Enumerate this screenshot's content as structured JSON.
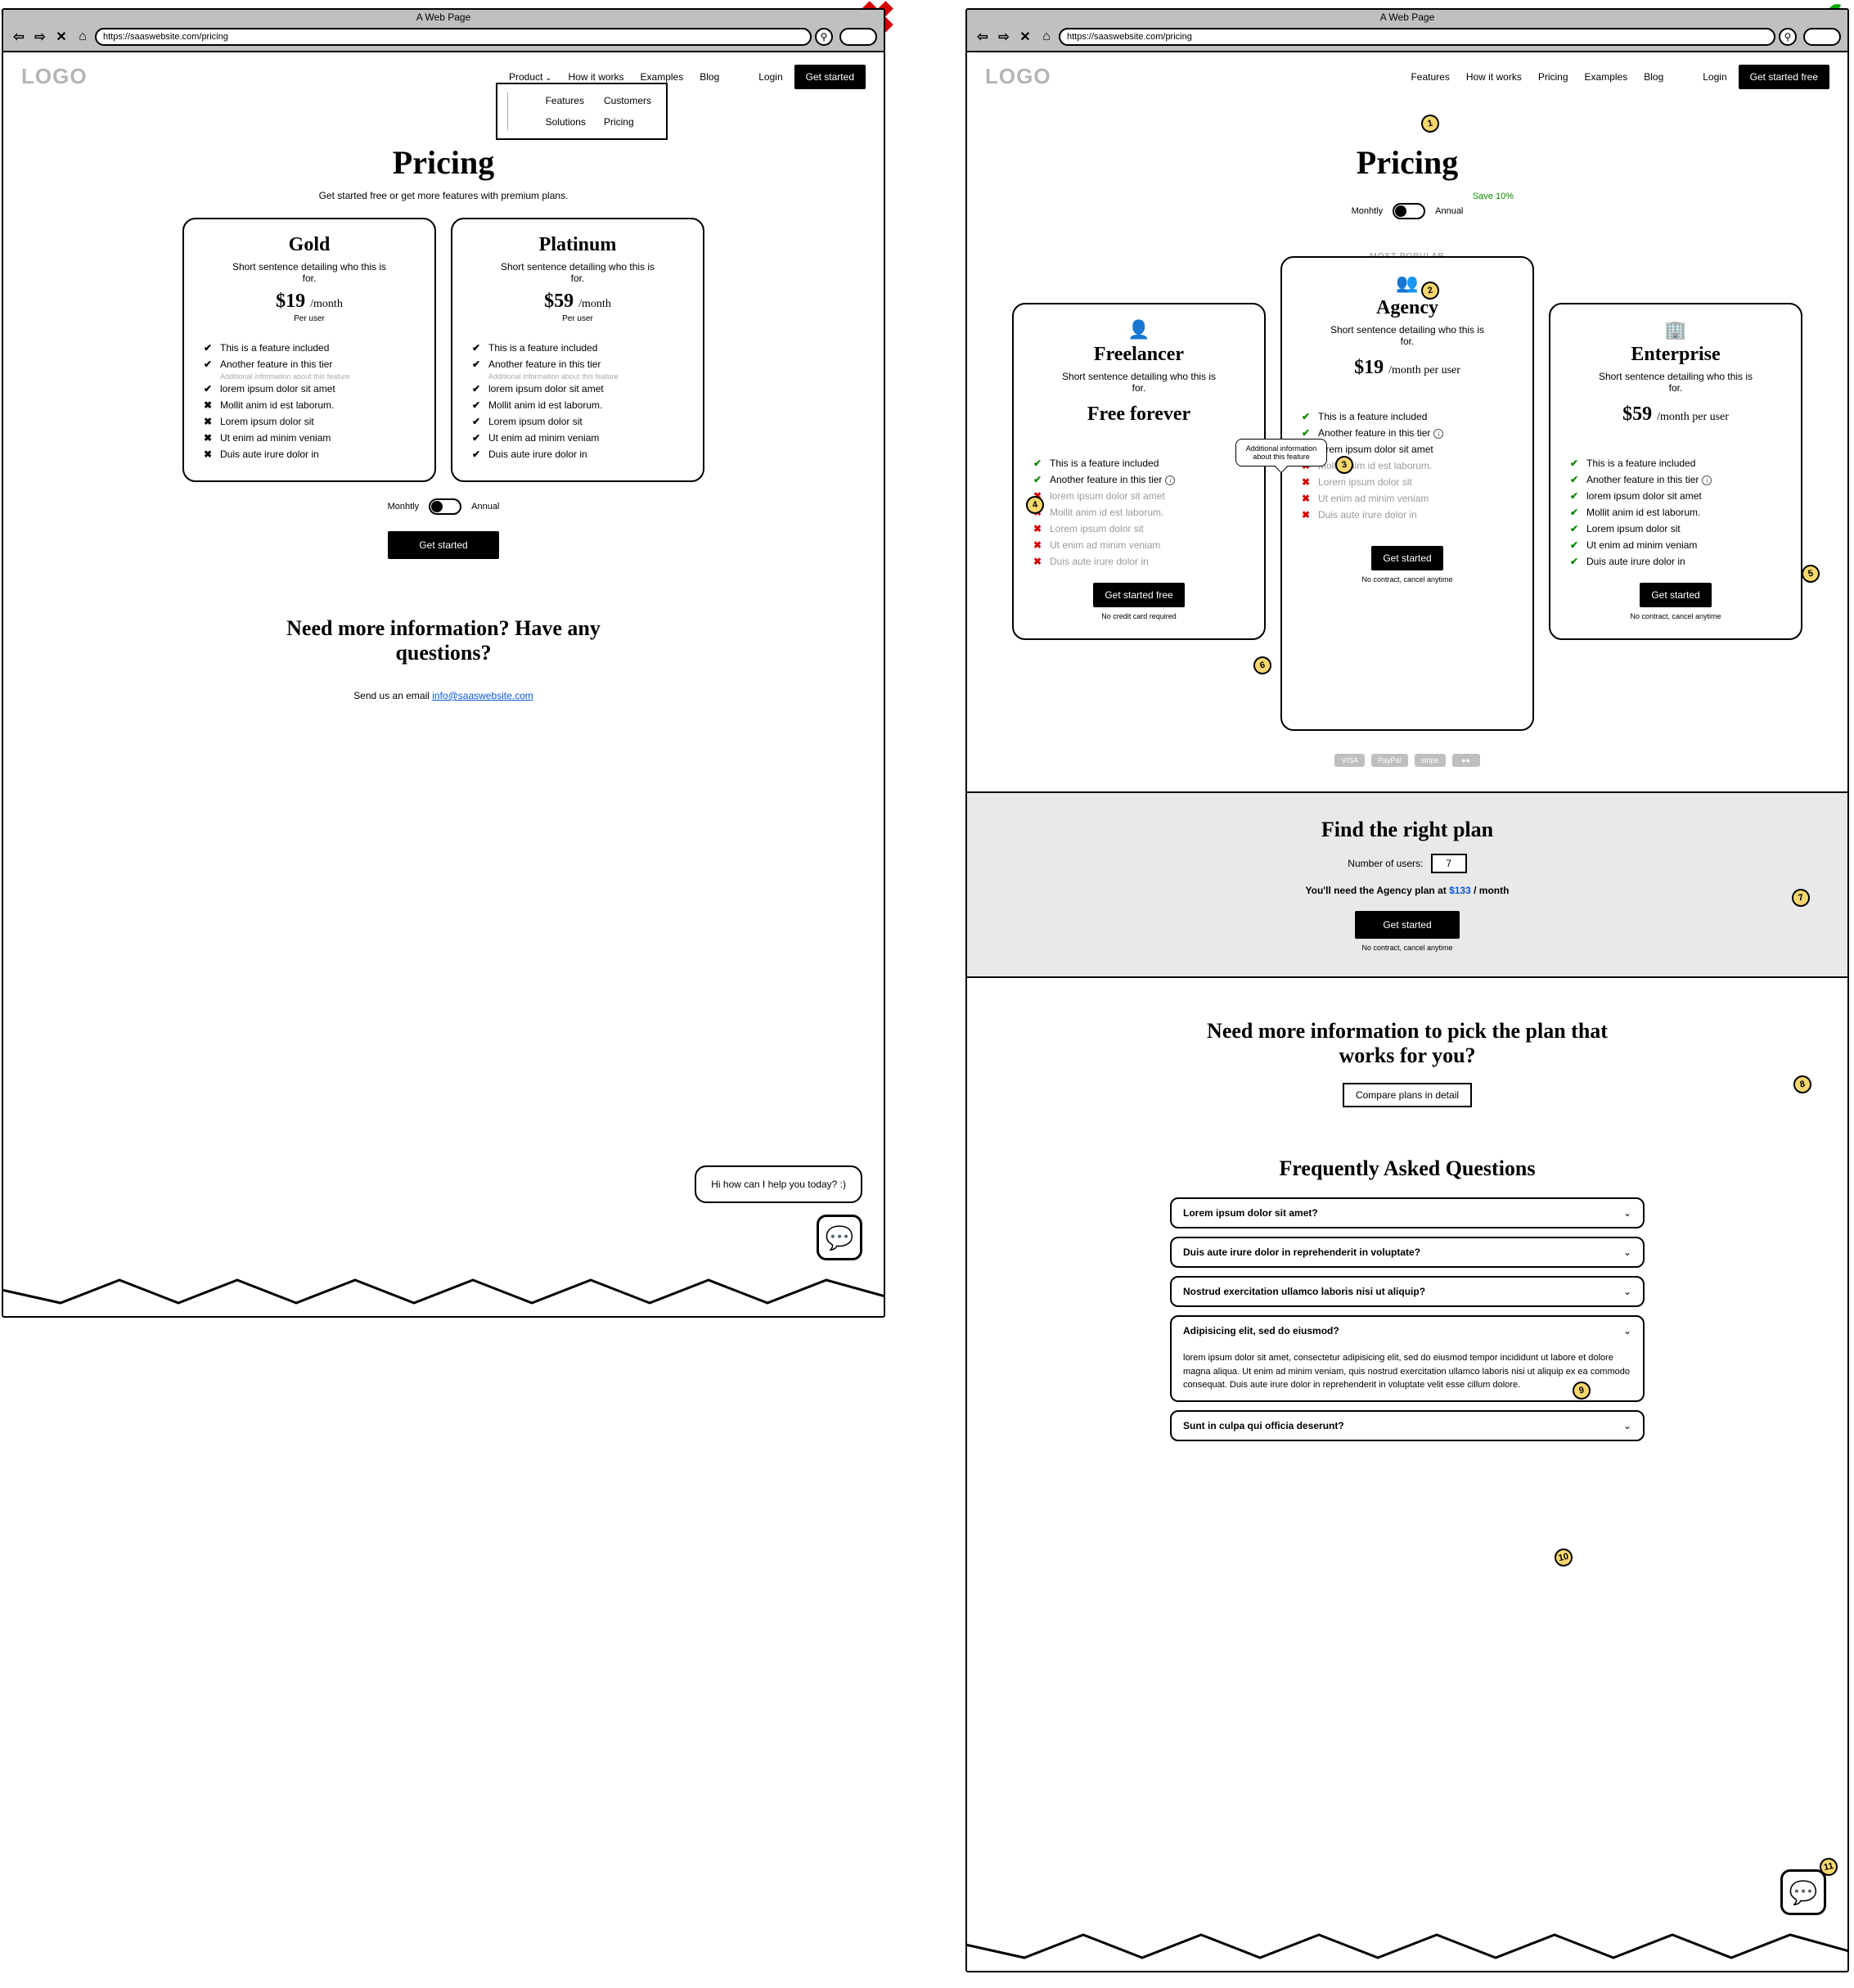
{
  "judgement": {
    "bad": "✖",
    "good": "✔"
  },
  "browser": {
    "title": "A Web Page",
    "url": "https://saaswebsite.com/pricing",
    "icons": {
      "back": "⇦",
      "fwd": "⇨",
      "close": "✕",
      "home": "⌂",
      "search": "⚲"
    }
  },
  "left": {
    "logo": "LOGO",
    "nav": [
      "Product",
      "How it works",
      "Examples",
      "Blog"
    ],
    "login": "Login",
    "cta": "Get started",
    "dropdown": {
      "col1": [
        "Features",
        "Solutions"
      ],
      "col2": [
        "Customers",
        "Pricing"
      ]
    },
    "h1": "Pricing",
    "sub": "Get started free or get more features with premium plans.",
    "plans": [
      {
        "name": "Gold",
        "who": "Short sentence detailing who this is for.",
        "price": "$19",
        "unit": "/month",
        "per": "Per user"
      },
      {
        "name": "Platinum",
        "who": "Short sentence detailing who this is for.",
        "price": "$59",
        "unit": "/month",
        "per": "Per user"
      }
    ],
    "features": [
      {
        "ok": true,
        "t": "This is a feature included"
      },
      {
        "ok": true,
        "t": "Another feature in this tier",
        "sub": "Additional information about this feature"
      },
      {
        "ok": true,
        "t": "lorem ipsum dolor sit amet"
      },
      {
        "ok": false,
        "t": "Mollit anim id est laborum."
      },
      {
        "ok": false,
        "t": "Lorem ipsum dolor sit"
      },
      {
        "ok": false,
        "t": "Ut enim ad minim veniam"
      },
      {
        "ok": false,
        "t": "Duis aute irure dolor in"
      }
    ],
    "features_plat": [
      {
        "ok": true,
        "t": "This is a feature included"
      },
      {
        "ok": true,
        "t": "Another feature in this tier",
        "sub": "Additional information about this feature"
      },
      {
        "ok": true,
        "t": "lorem ipsum dolor sit amet"
      },
      {
        "ok": true,
        "t": "Mollit anim id est laborum."
      },
      {
        "ok": true,
        "t": "Lorem ipsum dolor sit"
      },
      {
        "ok": true,
        "t": "Ut enim ad minim veniam"
      },
      {
        "ok": true,
        "t": "Duis aute irure dolor in"
      }
    ],
    "toggle": {
      "left": "Monhtly",
      "right": "Annual"
    },
    "cta2": "Get started",
    "info": {
      "h": "Need more information? Have any questions?",
      "line_pre": "Send us an email ",
      "email": "info@saaswebsite.com"
    },
    "chat": "Hi how can I help you today? :)"
  },
  "right": {
    "logo": "LOGO",
    "nav": [
      "Features",
      "How it works",
      "Pricing",
      "Examples",
      "Blog"
    ],
    "login": "Login",
    "cta": "Get started free",
    "h1": "Pricing",
    "toggle": {
      "left": "Monhtly",
      "right": "Annual",
      "save": "Save 10%"
    },
    "most_popular": "MOST POPULAR",
    "tooltip": "Additional information about this feature",
    "plans": [
      {
        "icon": "👤",
        "name": "Freelancer",
        "who": "Short sentence detailing who this is for.",
        "price_line": "Free forever",
        "cta": "Get started free",
        "note": "No credit card required",
        "features": [
          {
            "s": "y",
            "t": "This is a feature included"
          },
          {
            "s": "y",
            "t": "Another feature in this tier",
            "info": true
          },
          {
            "s": "n",
            "t": "lorem ipsum dolor sit amet"
          },
          {
            "s": "n",
            "t": "Mollit anim id est laborum."
          },
          {
            "s": "n",
            "t": "Lorem ipsum dolor sit"
          },
          {
            "s": "n",
            "t": "Ut enim ad minim veniam"
          },
          {
            "s": "n",
            "t": "Duis aute irure dolor in"
          }
        ]
      },
      {
        "icon": "👥",
        "name": "Agency",
        "who": "Short sentence detailing who this is for.",
        "price": "$19",
        "unit": "/month per user",
        "cta": "Get started",
        "note": "No contract, cancel anytime",
        "features": [
          {
            "s": "y",
            "t": "This is a feature included"
          },
          {
            "s": "y",
            "t": "Another feature in this tier",
            "info": true
          },
          {
            "s": "y",
            "t": "lorem ipsum dolor sit amet"
          },
          {
            "s": "n",
            "t": "Mollit anim id est laborum."
          },
          {
            "s": "n",
            "t": "Lorem ipsum dolor sit"
          },
          {
            "s": "n",
            "t": "Ut enim ad minim veniam"
          },
          {
            "s": "n",
            "t": "Duis aute irure dolor in"
          }
        ]
      },
      {
        "icon": "🏢",
        "name": "Enterprise",
        "who": "Short sentence detailing who this is for.",
        "price": "$59",
        "unit": "/month per user",
        "cta": "Get started",
        "note": "No contract, cancel anytime",
        "features": [
          {
            "s": "y",
            "t": "This is a feature included"
          },
          {
            "s": "y",
            "t": "Another feature in this tier",
            "info": true
          },
          {
            "s": "y",
            "t": "lorem ipsum dolor sit amet"
          },
          {
            "s": "y",
            "t": "Mollit anim id est laborum."
          },
          {
            "s": "y",
            "t": "Lorem ipsum dolor sit"
          },
          {
            "s": "y",
            "t": "Ut enim ad minim veniam"
          },
          {
            "s": "y",
            "t": "Duis aute irure dolor in"
          }
        ]
      }
    ],
    "payments": [
      "VISA",
      "PayPal",
      "stripe",
      "●●"
    ],
    "find": {
      "h": "Find the right plan",
      "label": "Number of users:",
      "value": "7",
      "result_pre": "You'll need the Agency plan at ",
      "result_price": "$133",
      "result_post": " / month",
      "cta": "Get started",
      "note": "No contract, cancel anytime"
    },
    "compare": {
      "h": "Need more information to pick the plan that works for you?",
      "btn": "Compare plans in detail"
    },
    "faq": {
      "h": "Frequently Asked Questions",
      "items": [
        {
          "q": "Lorem ipsum dolor sit amet?"
        },
        {
          "q": "Duis aute irure dolor in reprehenderit in voluptate?"
        },
        {
          "q": "Nostrud exercitation ullamco laboris nisi ut aliquip?"
        },
        {
          "q": "Adipisicing elit, sed do eiusmod?",
          "open": true,
          "a": "lorem ipsum dolor sit amet, consectetur adipisicing elit, sed do eiusmod tempor incididunt ut labore et dolore magna aliqua. Ut enim ad minim veniam, quis nostrud exercitation ullamco laboris nisi ut aliquip ex ea commodo consequat. Duis aute irure dolor in reprehenderit in voluptate velit esse cillum dolore."
        },
        {
          "q": "Sunt in culpa qui officia deserunt?"
        }
      ]
    },
    "annotations": [
      "1",
      "2",
      "3",
      "4",
      "5",
      "6",
      "7",
      "8",
      "9",
      "10",
      "11"
    ]
  }
}
